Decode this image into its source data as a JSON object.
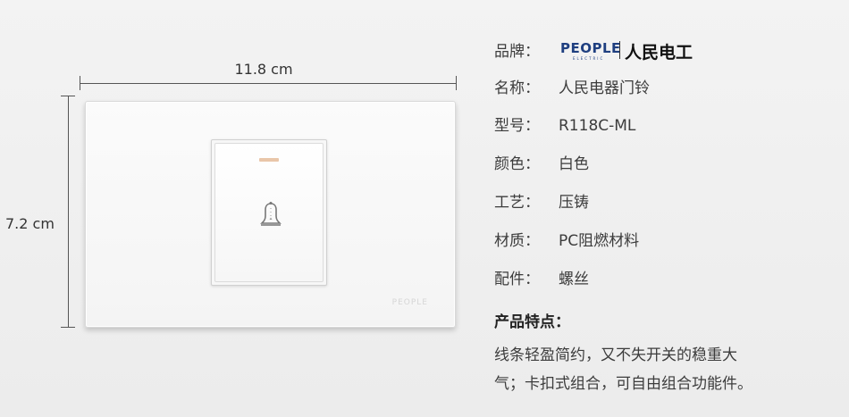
{
  "dimensions": {
    "width_label": "11.8 cm",
    "height_label": "7.2 cm"
  },
  "product_image": {
    "plate_logo_text": "PEOPLE",
    "icon": "bell-icon"
  },
  "brand": {
    "logo_en": "PEOPLE",
    "logo_en_sub": "ELECTRIC",
    "logo_cn": "人民电工"
  },
  "specs": [
    {
      "key": "品牌：",
      "value": ""
    },
    {
      "key": "名称：",
      "value": "人民电器门铃"
    },
    {
      "key": "型号：",
      "value": "R118C-ML"
    },
    {
      "key": "颜色：",
      "value": "白色"
    },
    {
      "key": "工艺：",
      "value": "压铸"
    },
    {
      "key": "材质：",
      "value": "PC阻燃材料"
    },
    {
      "key": "配件：",
      "value": "螺丝"
    }
  ],
  "features": {
    "title": "产品特点：",
    "lines": [
      "线条轻盈简约，又不失开关的稳重大",
      "气；卡扣式组合，可自由组合功能件。"
    ]
  },
  "colors": {
    "brand_blue": "#1f3f80",
    "indicator": "#e9c6a9"
  }
}
